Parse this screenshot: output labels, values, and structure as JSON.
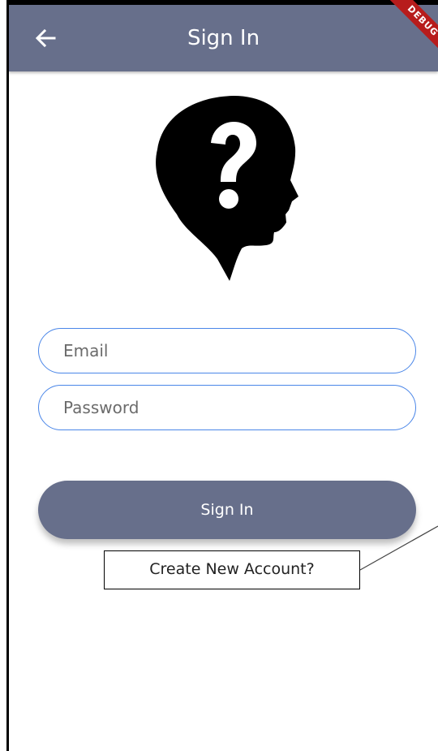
{
  "appbar": {
    "title": "Sign In",
    "back_icon": "arrow-left-icon",
    "debug_banner": "DEBUG",
    "color": "#676f8b"
  },
  "avatar": {
    "icon": "unknown-person-head-icon"
  },
  "form": {
    "email_placeholder": "Email",
    "password_placeholder": "Password",
    "field_border_color": "#4a86e8"
  },
  "actions": {
    "signin_label": "Sign In",
    "create_account_label": "Create New Account?"
  }
}
